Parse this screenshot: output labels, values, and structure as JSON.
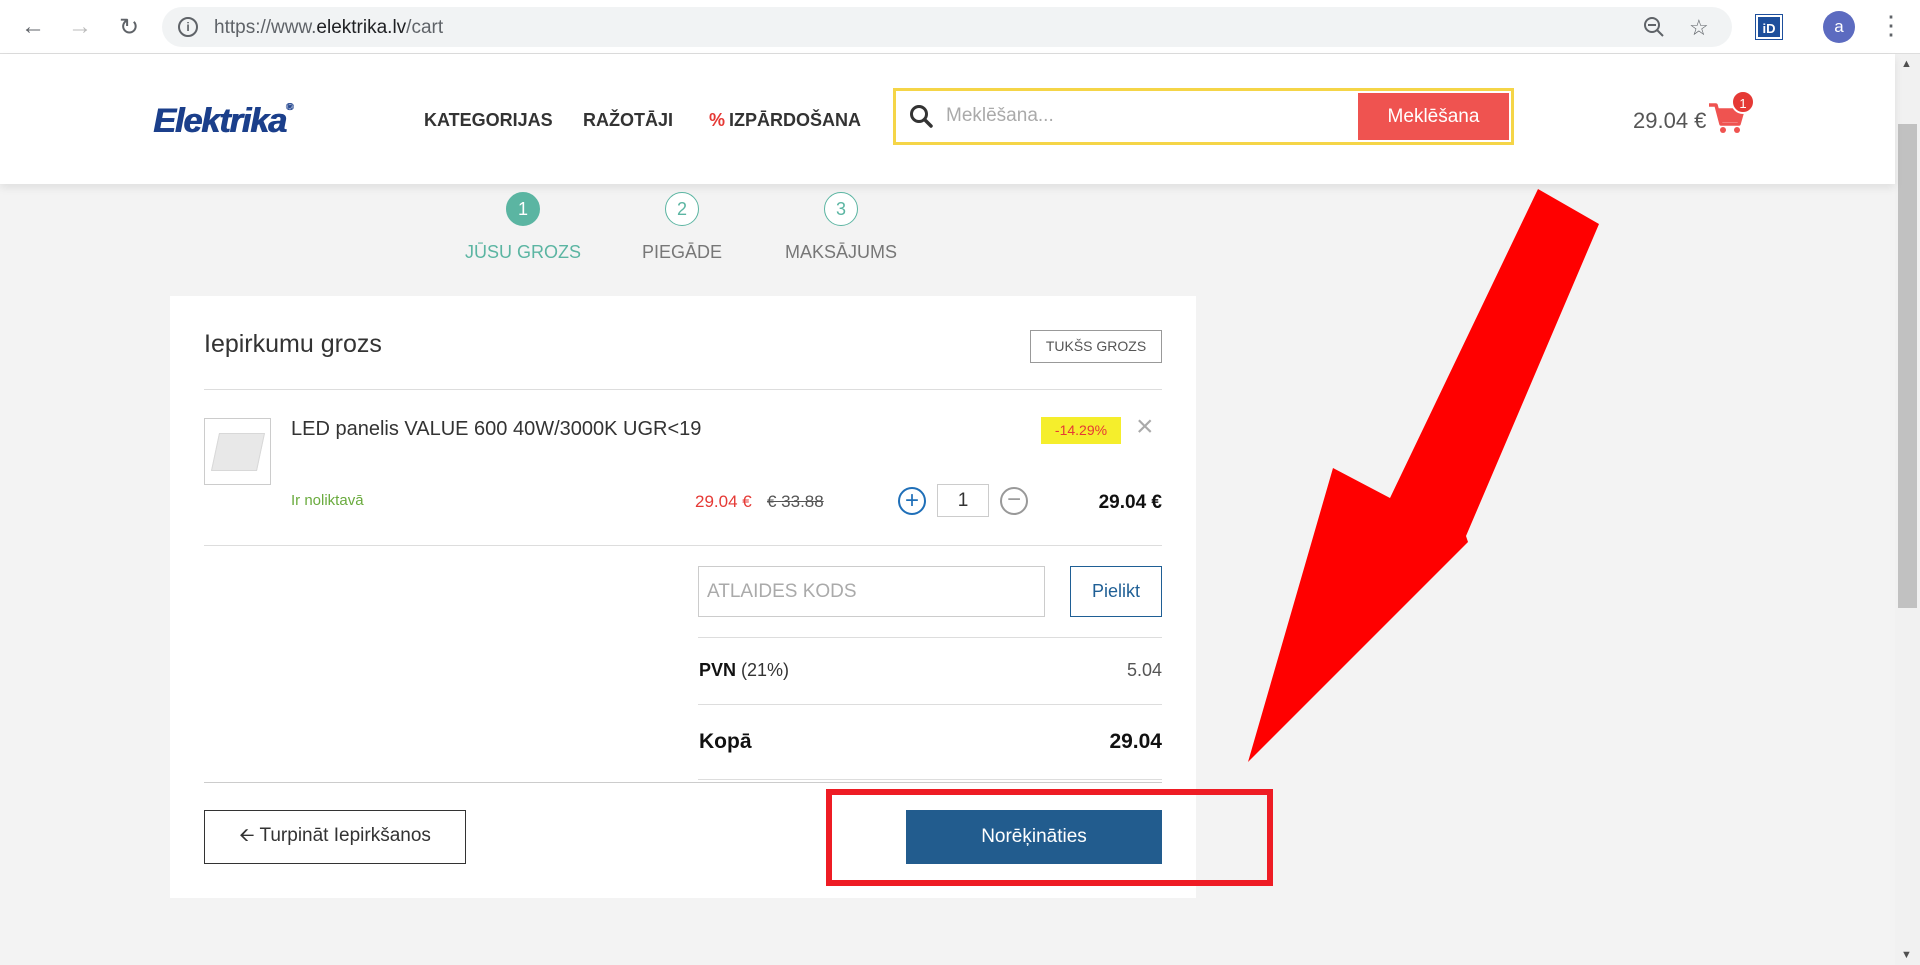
{
  "browser": {
    "url_prefix": "https://www.",
    "url_domain": "elektrika.lv",
    "url_path": "/cart",
    "extension_label": "iD",
    "profile_initial": "a"
  },
  "header": {
    "logo_text": "Elektrika",
    "menu": [
      "KATEGORIJAS",
      "RAŽOTĀJI",
      "IZPĀRDOŠANA"
    ],
    "sale_symbol": "%",
    "search_placeholder": "Meklēšana...",
    "search_button": "Meklēšana",
    "cart_total": "29.04 €",
    "cart_count": "1"
  },
  "steps": [
    {
      "number": "1",
      "label": "JŪSU GROZS",
      "active": true
    },
    {
      "number": "2",
      "label": "PIEGĀDE",
      "active": false
    },
    {
      "number": "3",
      "label": "MAKSĀJUMS",
      "active": false
    }
  ],
  "cart": {
    "title": "Iepirkumu grozs",
    "empty_button": "TUKŠS GROZS",
    "item": {
      "name": "LED panelis VALUE 600 40W/3000K UGR<19",
      "discount": "-14.29%",
      "stock": "Ir noliktavā",
      "price_new": "29.04 €",
      "price_old": "€ 33.88",
      "quantity": "1",
      "line_total": "29.04 €"
    },
    "coupon_placeholder": "ATLAIDES KODS",
    "apply_button": "Pielikt",
    "vat_label": "PVN",
    "vat_rate": "(21%)",
    "vat_value": "5.04",
    "total_label": "Kopā",
    "total_value": "29.04",
    "continue_button": "Turpināt Iepirkšanos",
    "checkout_button": "Norēķināties"
  },
  "annotation_color": "#ee1c24"
}
